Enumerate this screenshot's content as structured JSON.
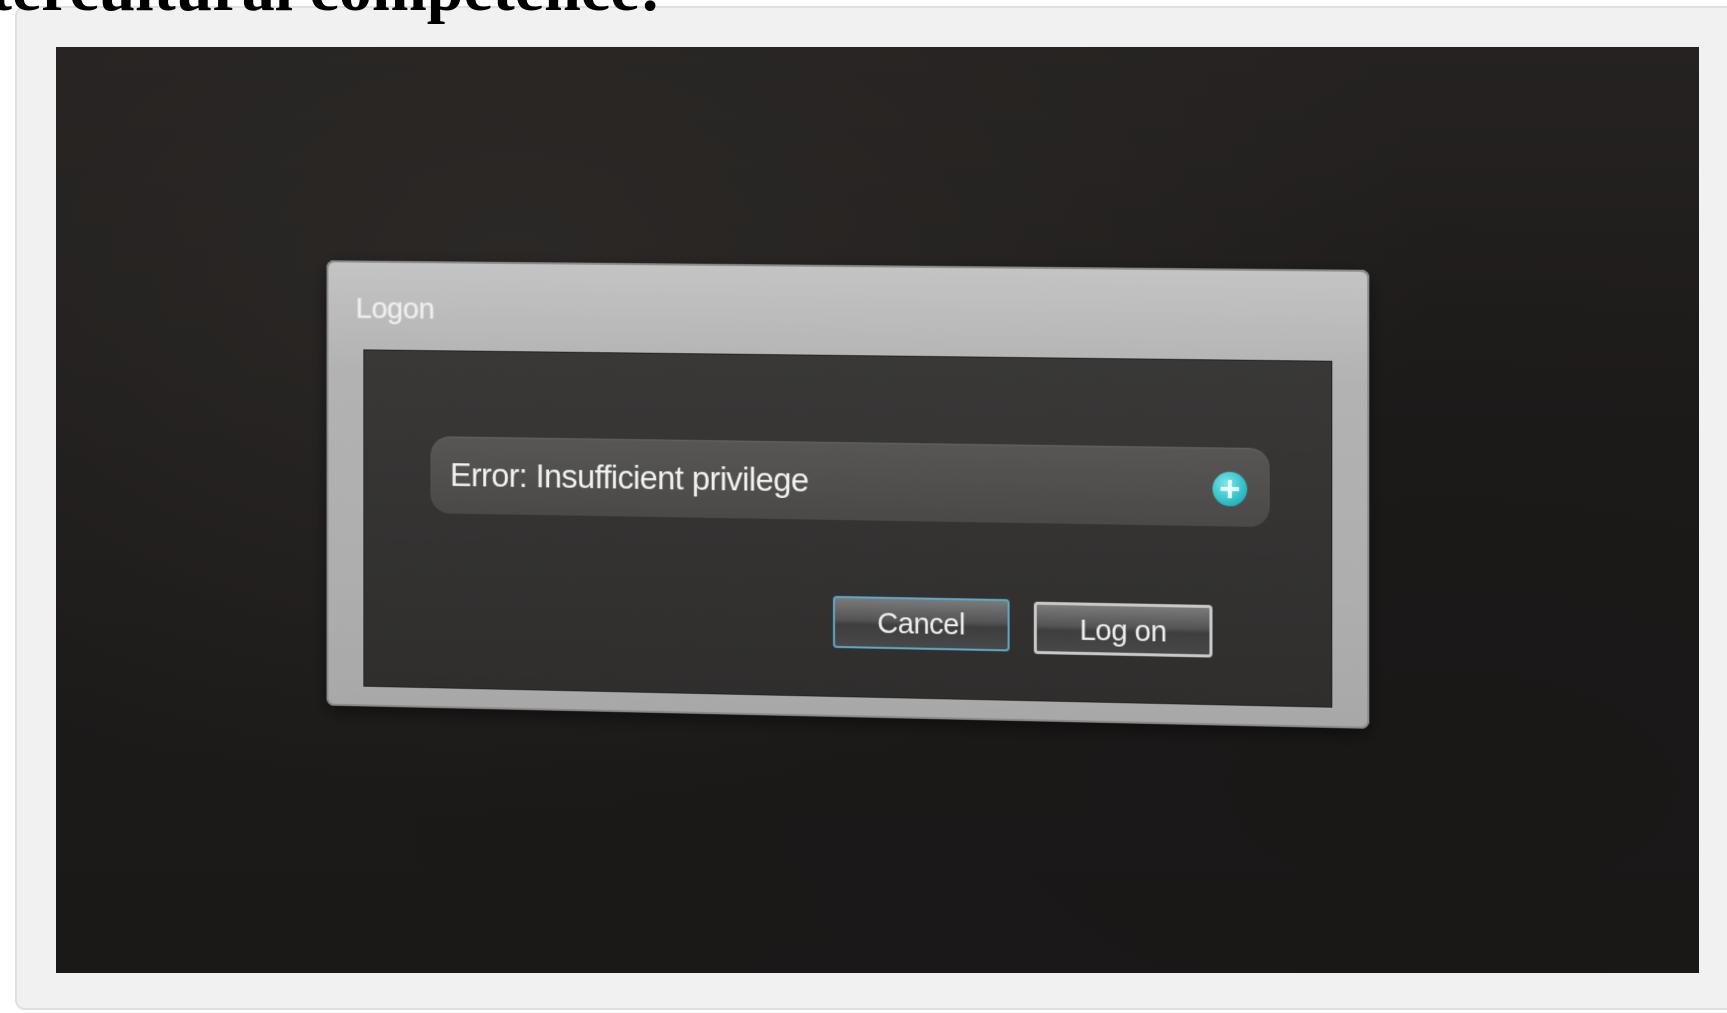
{
  "page": {
    "heading_fragment": "tercultural competence:"
  },
  "dialog": {
    "title": "Logon",
    "error_message": "Error: Insufficient privilege",
    "expand_icon": "plus-circle-icon",
    "cancel_label": "Cancel",
    "logon_label": "Log on"
  },
  "colors": {
    "icon_accent": "#2ebfc6",
    "cancel_border": "#5ea8c9"
  }
}
